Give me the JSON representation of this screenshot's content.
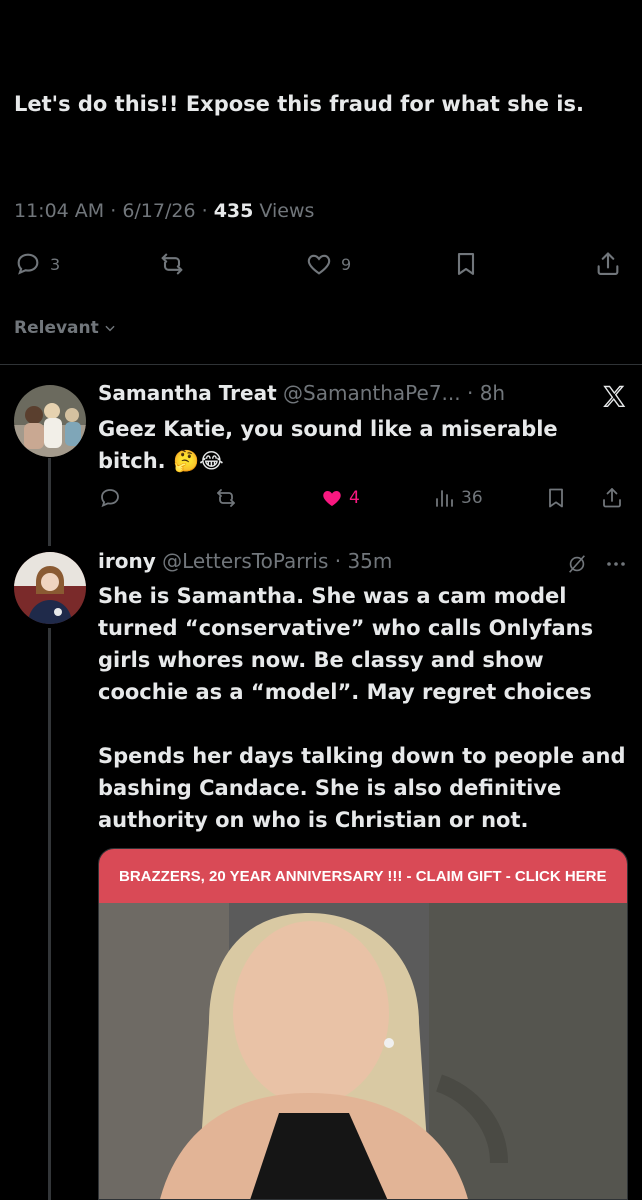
{
  "main_tweet": {
    "text": "Let's do this!! Expose this fraud for what she is.",
    "time": "11:04 AM",
    "date": "6/17/26",
    "views_count": "435",
    "views_label": "Views",
    "reply_count": "3",
    "like_count": "9"
  },
  "sort": {
    "label": "Relevant"
  },
  "replies": [
    {
      "name": "Samantha Treat",
      "handle": "@SamanthaPe7...",
      "age": "8h",
      "text": "Geez Katie, you sound like a miserable bitch. 🤔😂",
      "like_count": "4",
      "view_count": "36"
    },
    {
      "name": "irony",
      "handle": "@LettersToParris",
      "age": "35m",
      "text_p1": "She is Samantha. She was a cam model turned “conservative” who calls Onlyfans girls whores now. Be classy and show coochie  as a “model”. May regret choices",
      "text_p2": "Spends her days talking down to people and bashing Candace. She is also definitive authority on who is Christian or not.",
      "ad_banner": "BRAZZERS, 20 YEAR ANNIVERSARY !!! - CLAIM GIFT - CLICK HERE"
    }
  ],
  "colors": {
    "bg": "#000000",
    "text": "#e7e9ea",
    "muted": "#71767b",
    "like": "#f91880",
    "ad": "#d94a56"
  }
}
